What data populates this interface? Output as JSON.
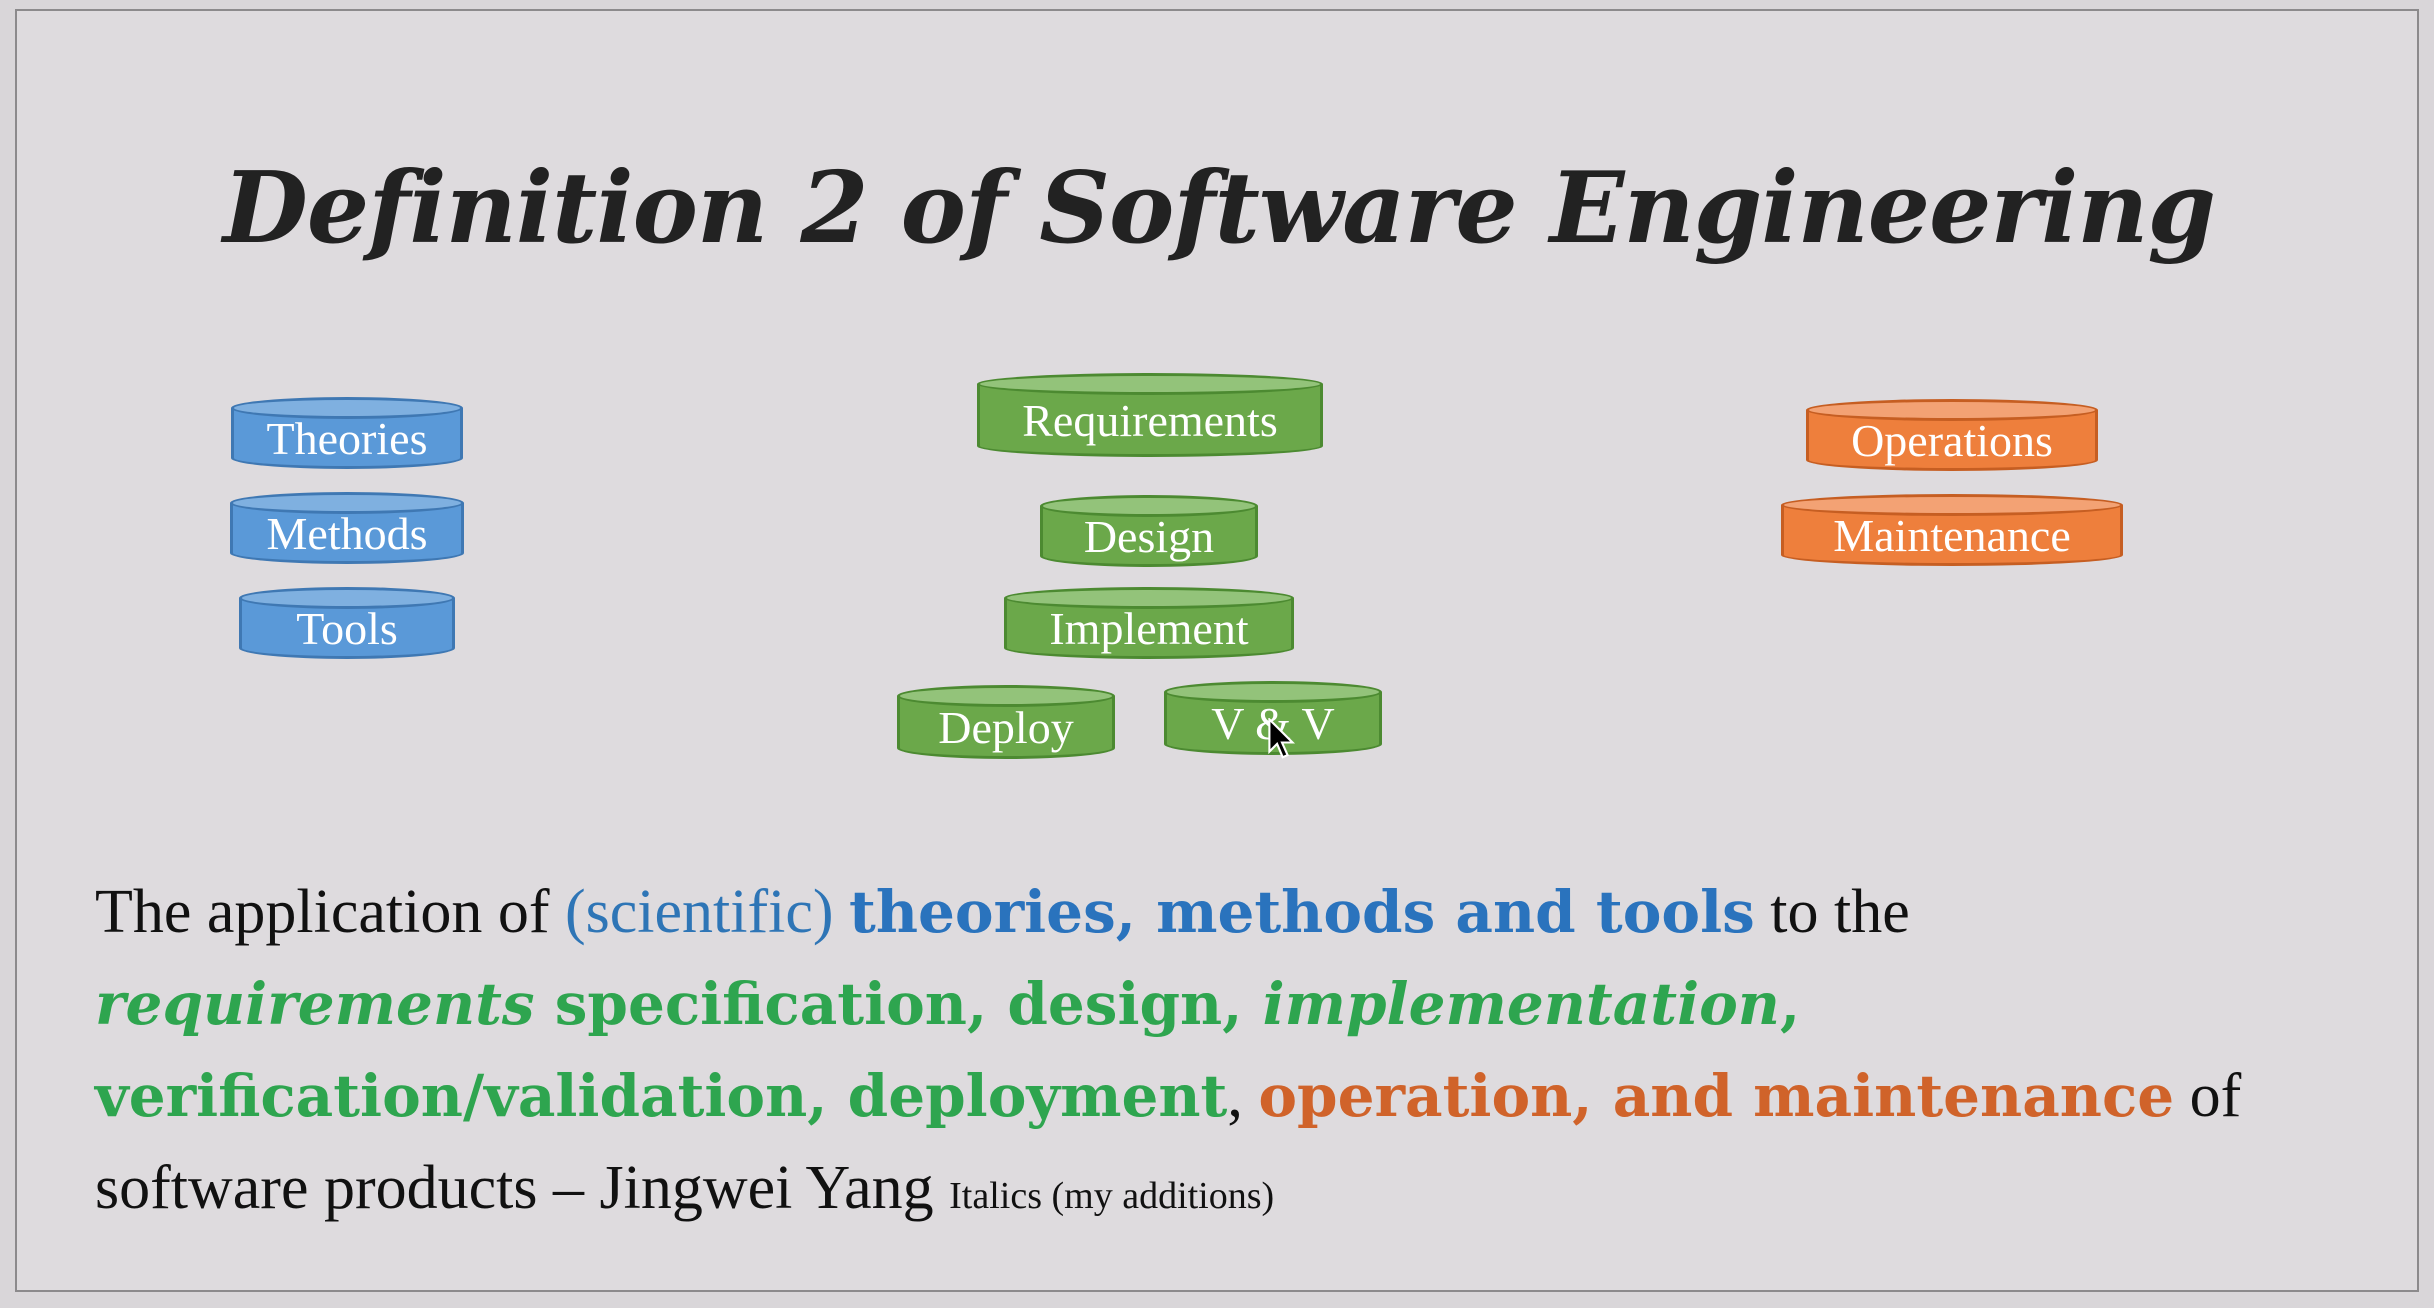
{
  "title": "Definition 2 of Software Engineering",
  "cylinders": {
    "theories": "Theories",
    "methods": "Methods",
    "tools": "Tools",
    "requirements": "Requirements",
    "design": "Design",
    "implement": "Implement",
    "deploy": "Deploy",
    "vv": "V & V",
    "operations": "Operations",
    "maintenance": "Maintenance"
  },
  "definition": {
    "s1": "The application of ",
    "s2": "(scientific) ",
    "s3": "theories, methods and tools",
    "s4": " to the ",
    "s5": "requirements",
    "s6": " specification, design, ",
    "s7": "implementation",
    "s8": ", verification/validation, deployment",
    "s9": ", ",
    "s10": "operation, and maintenance",
    "s11": " of software products – Jingwei Yang ",
    "s12": "Italics (my additions)"
  },
  "colors": {
    "blue": "#5a99d8",
    "green": "#6ba84a",
    "orange": "#ee7f3c"
  }
}
